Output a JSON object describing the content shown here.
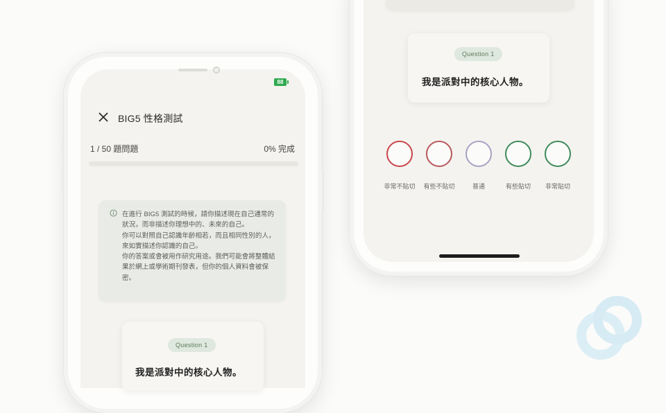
{
  "status_bar": {
    "battery": "88"
  },
  "header": {
    "title": "BIG5 性格測試",
    "close_icon": "close-icon"
  },
  "progress": {
    "count": "1 / 50 題問題",
    "percent_label": "0% 完成",
    "value": 0
  },
  "info": {
    "icon": "info-icon",
    "lines": [
      "在進行 BIG5 測試的時候，請你描述現在自己通常的狀況，而非描述你理想中的、未來的自己。",
      "你可以對照自己認識年齡相若，而且相同性別的人，來如實描述你認識的自己。",
      "你的答案或會被用作研究用途。我們可能會將整體結果於網上或學術期刊發表，但你的個人資料會被保密。"
    ]
  },
  "question_left": {
    "badge": "Question 1",
    "text": "我是派對中的核心人物。"
  },
  "question_right": {
    "badge": "Question 1",
    "text": "我是派對中的核心人物。"
  },
  "choices": [
    {
      "label": "非常不貼切",
      "color": "#c9454a"
    },
    {
      "label": "有些不貼切",
      "color": "#b8585c"
    },
    {
      "label": "普通",
      "color": "#a9a2c2"
    },
    {
      "label": "有些貼切",
      "color": "#3e8a5b"
    },
    {
      "label": "非常貼切",
      "color": "#3e8a5b"
    }
  ],
  "colors": {
    "accent_green": "#2fa94e",
    "badge_bg": "#dfe8de",
    "logo": "#d6ebf3"
  }
}
